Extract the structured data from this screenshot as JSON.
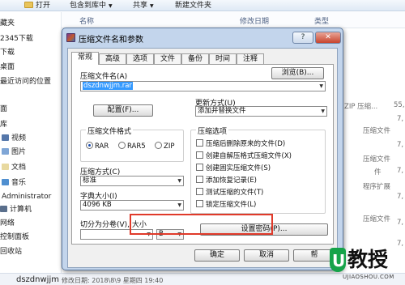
{
  "explorer": {
    "toolbar": {
      "open": "打开",
      "include_in_library": "包含到库中",
      "share": "共享",
      "new_folder": "新建文件夹"
    },
    "nav": [
      {
        "label": "藏夹"
      },
      {
        "label": "2345下载"
      },
      {
        "label": "下载"
      },
      {
        "label": "桌面"
      },
      {
        "label": "最近访问的位置"
      },
      {
        "label": "面"
      },
      {
        "label": "库"
      },
      {
        "label": "视频"
      },
      {
        "label": "图片"
      },
      {
        "label": "文档"
      },
      {
        "label": "音乐"
      },
      {
        "label": "Administrator"
      },
      {
        "label": "计算机"
      },
      {
        "label": "网络"
      },
      {
        "label": "控制面板"
      },
      {
        "label": "回收站"
      }
    ],
    "columns": {
      "name": "名称",
      "modified": "修改日期",
      "type": "类型"
    },
    "bg_cells": {
      "zip_type": "ZIP 压缩...",
      "size_55": "55,0",
      "compressed_1": "压缩文件",
      "compressed_2": "压缩文件",
      "compressed_3": "件",
      "app_ext": "程序扩展",
      "compressed_4": "压缩文件",
      "size_7a": "7,",
      "size_7b": "7,",
      "size_7c": "7,",
      "size_7d": "7,",
      "size_7e": "7,",
      "size_7f": "7,"
    },
    "status": {
      "filename": "dszdnwjjm",
      "meta": "修改日期: 2018\\8\\9 星期四 19:40"
    }
  },
  "dialog": {
    "title": "压缩文件名和参数",
    "help_label": "?",
    "close_label": "✕",
    "tabs": [
      "常规",
      "高级",
      "选项",
      "文件",
      "备份",
      "时间",
      "注释"
    ],
    "archive_name_label": "压缩文件名(A)",
    "browse_label": "浏览(B)...",
    "archive_name_value": "dszdnwjjm.rar",
    "profiles_label": "配置(F)...",
    "update_mode_label": "更新方式(U)",
    "update_mode_value": "添加并替换文件",
    "format_group_label": "压缩文件格式",
    "formats": [
      "RAR",
      "RAR5",
      "ZIP"
    ],
    "method_label": "压缩方式(C)",
    "method_value": "标准",
    "dict_label": "字典大小(I)",
    "dict_value": "4096 KB",
    "split_label": "切分为分卷(V), 大小",
    "split_unit": "B",
    "options_group_label": "压缩选项",
    "options": [
      "压缩后删除原来的文件(D)",
      "创建自解压格式压缩文件(X)",
      "创建固实压缩文件(S)",
      "添加恢复记录(E)",
      "测试压缩的文件(T)",
      "锁定压缩文件(L)"
    ],
    "set_password_label": "设置密码(P)...",
    "ok_label": "确定",
    "cancel_label": "取消",
    "help_button_label": "帮"
  },
  "watermark": {
    "logo_letter": "U",
    "logo_text": "教授",
    "url": "UJIAOSHOU.COM"
  },
  "colors": {
    "highlight": "#e03a2a",
    "selection": "#3399ff",
    "title_bar": "#c3d5ec"
  }
}
